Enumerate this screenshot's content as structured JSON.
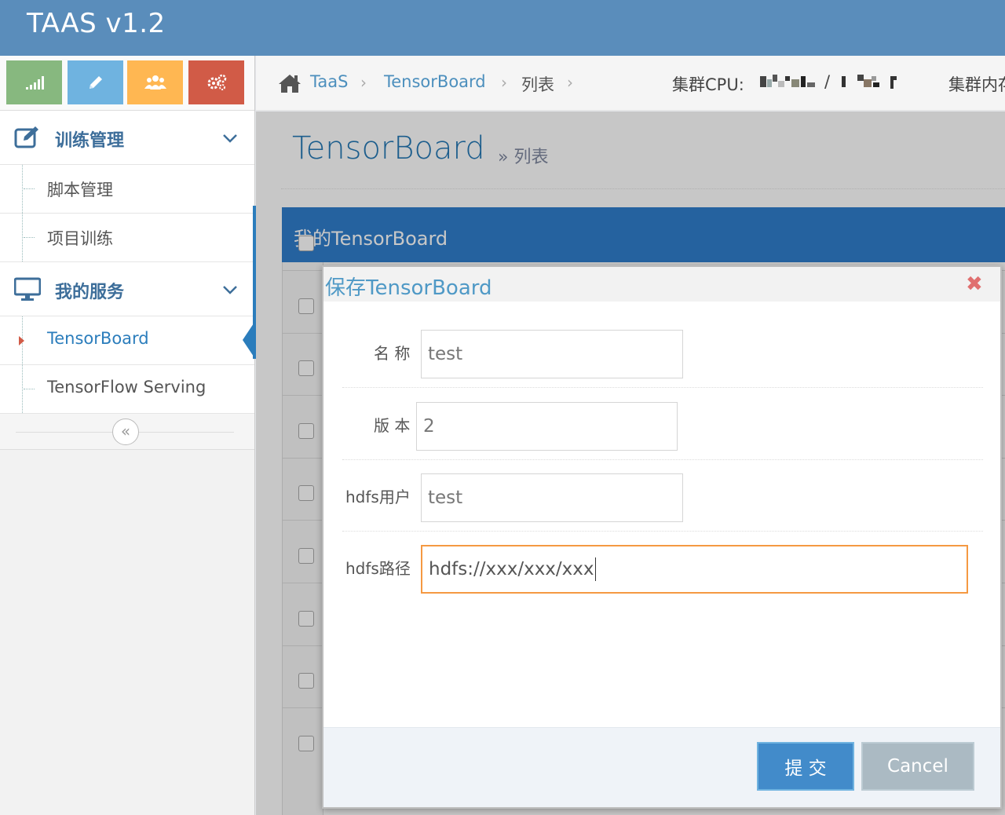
{
  "app": {
    "title": "TAAS v1.2"
  },
  "colors": {
    "navbar": "#5a8dbb",
    "primary": "#428bca",
    "focus_border": "#f59942",
    "table_header": "#307ecc"
  },
  "shortcuts": [
    {
      "icon": "signal-icon",
      "color": "#87b87f"
    },
    {
      "icon": "pencil-icon",
      "color": "#6fb3e0"
    },
    {
      "icon": "users-icon",
      "color": "#ffb752"
    },
    {
      "icon": "cogs-icon",
      "color": "#d15b47"
    }
  ],
  "sidebar": {
    "groups": [
      {
        "label": "训练管理",
        "icon": "edit-icon",
        "items": [
          {
            "label": "脚本管理"
          },
          {
            "label": "项目训练"
          }
        ]
      },
      {
        "label": "我的服务",
        "icon": "desktop-icon",
        "items": [
          {
            "label": "TensorBoard",
            "active": true
          },
          {
            "label": "TensorFlow Serving"
          }
        ]
      }
    ],
    "collapse_icon": "double-angle-left-icon"
  },
  "breadcrumbs": {
    "items": [
      "TaaS",
      "TensorBoard",
      "列表"
    ],
    "cluster_cpu_label": "集群CPU:",
    "cluster_sep": "/",
    "cluster_mem_label": "集群内存"
  },
  "page": {
    "title": "TensorBoard",
    "subtitle": "» 列表"
  },
  "table": {
    "title": "我的TensorBoard",
    "row_count": 9
  },
  "modal": {
    "title": "保存TensorBoard",
    "close_icon": "close-icon",
    "fields": [
      {
        "label": "名 称",
        "value": "test"
      },
      {
        "label": "版 本",
        "value": "2"
      },
      {
        "label": "hdfs用户",
        "value": "test"
      },
      {
        "label": "hdfs路径",
        "value": "hdfs://xxx/xxx/xxx"
      }
    ],
    "submit_label": "提 交",
    "cancel_label": "Cancel"
  }
}
